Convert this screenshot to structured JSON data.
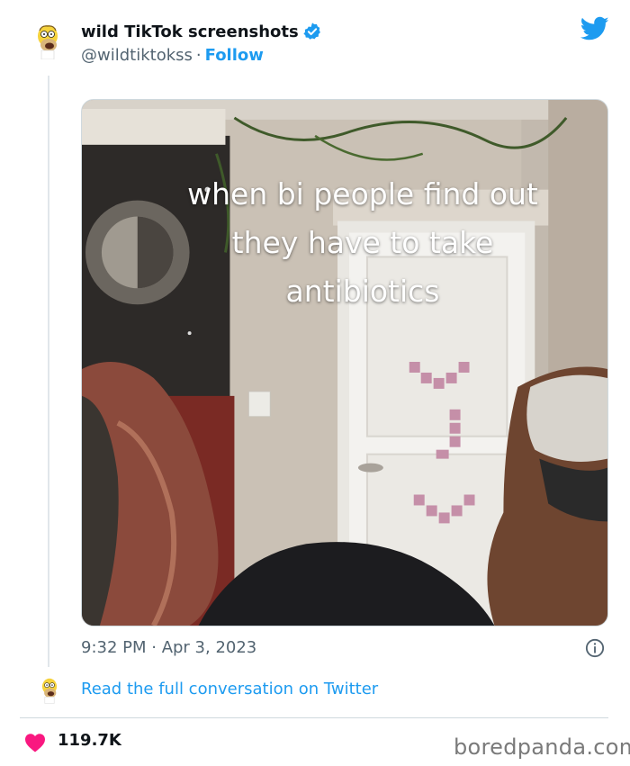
{
  "tweet": {
    "author_name": "wild TikTok screenshots",
    "author_handle": "@wildtiktokss",
    "separator": "·",
    "follow_label": "Follow",
    "timestamp": "9:32 PM · Apr 3, 2023",
    "read_link_label": "Read the full conversation on Twitter",
    "like_count": "119.7K",
    "media_caption_lines": [
      "when bi people find out",
      "they have to take",
      "antibiotics"
    ]
  },
  "footer": {
    "watermark": "boredpanda.com"
  },
  "icons": {
    "avatar": "homer-simpson-avatar-icon",
    "verified": "verified-badge-icon",
    "brand": "twitter-bird-icon",
    "info": "info-icon",
    "like": "heart-icon"
  },
  "colors": {
    "link": "#1d9bf0",
    "heart": "#f91880",
    "verified": "#1d9bf0",
    "muted_text": "#536471"
  }
}
